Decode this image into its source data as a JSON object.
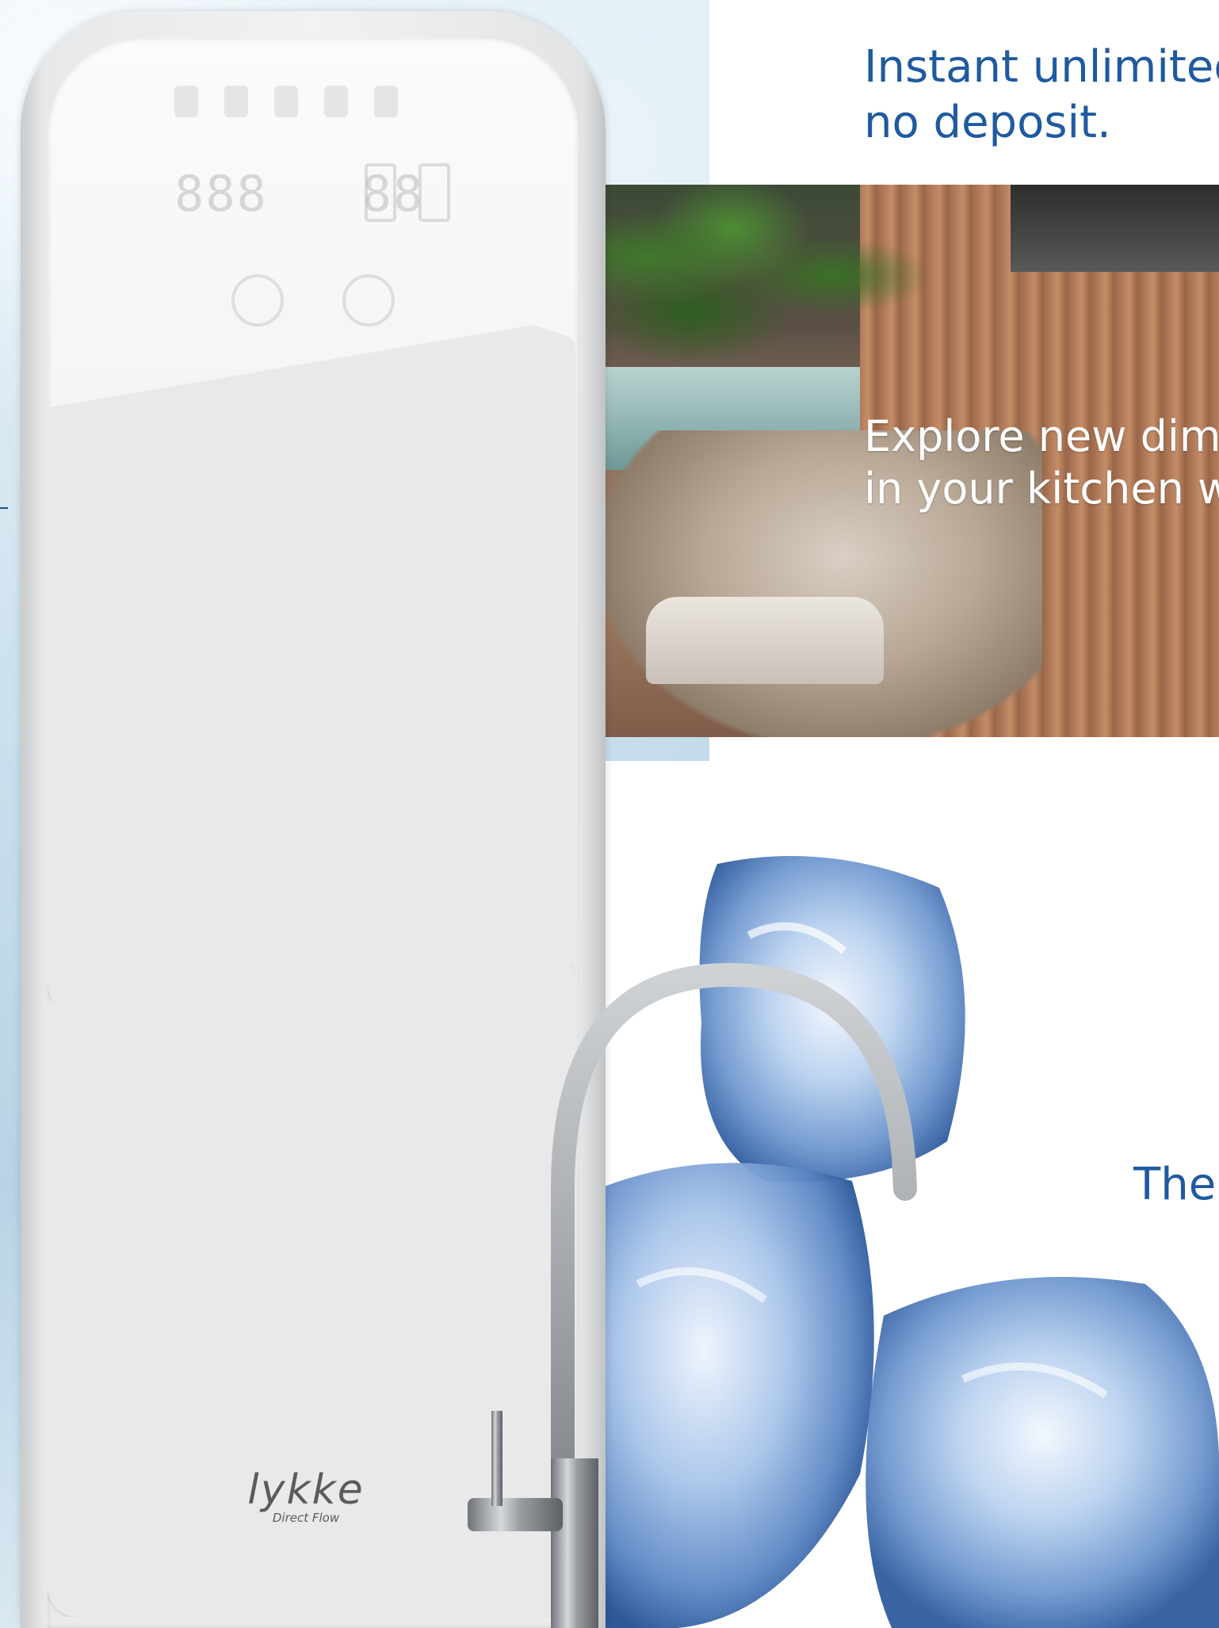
{
  "headline": {
    "line1": "Instant unlimited",
    "line2": "no deposit."
  },
  "kitchen_caption": {
    "line1": "Explore new dim",
    "line2": "in your kitchen w"
  },
  "bottom_text": "The",
  "device": {
    "brand": "lykke",
    "model": "Direct Flow",
    "display_digits_left": "888",
    "display_digits_right": "88"
  },
  "colors": {
    "headline_blue": "#1f5aa0",
    "device_body": "#efefef",
    "ice_blue": "#9cc0e6"
  },
  "icons": [
    "faucet-icon",
    "ice-cube-icon",
    "water-purifier-icon"
  ]
}
